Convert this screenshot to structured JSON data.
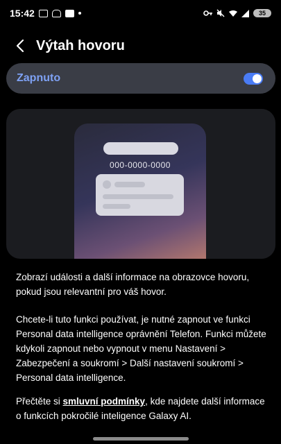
{
  "status_bar": {
    "time": "15:42",
    "left_icons": [
      "screenshot-icon",
      "hand-icon",
      "linkedin-icon"
    ],
    "right_icons": [
      "key-icon",
      "mute-icon",
      "wifi-icon",
      "signal-icon"
    ],
    "battery": "35"
  },
  "header": {
    "back_icon": "chevron-left-icon",
    "title": "Výtah hovoru"
  },
  "switch": {
    "label": "Zapnuto",
    "on": true,
    "accent": "#4a7cf5",
    "label_color": "#7ea1f3"
  },
  "illustration": {
    "phone_number": "000-0000-0000"
  },
  "description": {
    "p1": "Zobrazí události a další informace na obrazovce hovoru, pokud jsou relevantní pro váš hovor.",
    "p2": "Chcete-li tuto funkci používat, je nutné zapnout ve funkci Personal data intelligence oprávnění Telefon. Funkci můžete kdykoli zapnout nebo vypnout v menu Nastavení > Zabezpečení a soukromí > Další nastavení soukromí > Personal data intelligence.",
    "p3_prefix": "Přečtěte si ",
    "p3_link": "smluvní podmínky",
    "p3_suffix": ", kde najdete další informace o funkcích pokročilé inteligence Galaxy AI."
  }
}
